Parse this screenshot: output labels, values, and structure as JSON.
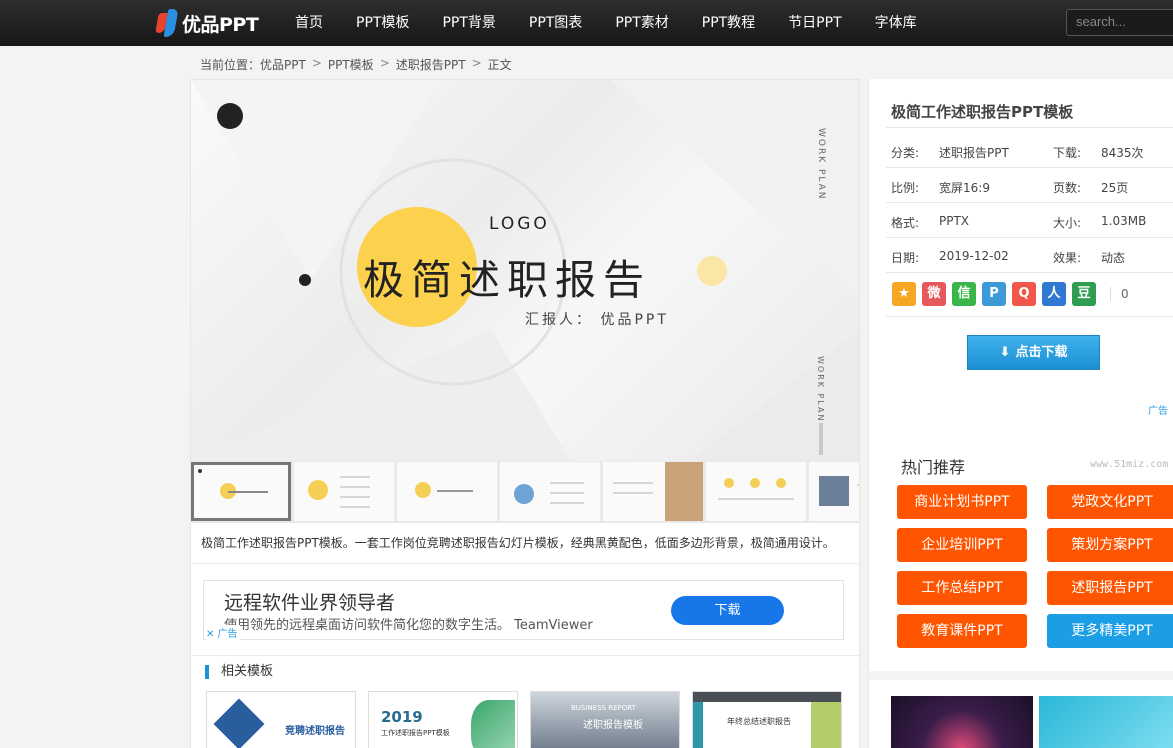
{
  "header": {
    "logo_text": "优品PPT",
    "nav": [
      "首页",
      "PPT模板",
      "PPT背景",
      "PPT图表",
      "PPT素材",
      "PPT教程",
      "节日PPT",
      "字体库"
    ],
    "search_placeholder": "search..."
  },
  "breadcrumb": [
    "当前位置：优品PPT",
    "PPT模板",
    "述职报告PPT",
    "正文"
  ],
  "breadcrumb_sep": ">",
  "preview": {
    "logo": "LOGO",
    "title": "极简述职报告",
    "reporter": "汇报人： 优品PPT",
    "side_text": "WORK PLAN",
    "side_text_2": "WORK PLAN"
  },
  "description": "极简工作述职报告PPT模板。一套工作岗位竞聘述职报告幻灯片模板，经典黑黄配色，低面多边形背景，极简通用设计。",
  "ad": {
    "title": "远程软件业界领导者",
    "subtitle": "使用领先的远程桌面访问软件简化您的数字生活。 TeamViewer",
    "button": "下载",
    "tag": "✕ 广告"
  },
  "related": {
    "title": "相关模板",
    "thumbs": [
      "竞聘述职报告",
      "2019",
      "工作述职报告PPT模板",
      "BUSINESS REPORT",
      "述职报告模板",
      "年终总结述职报告"
    ]
  },
  "sidebar": {
    "title": "极简工作述职报告PPT模板",
    "meta": [
      {
        "label": "分类:",
        "value": "述职报告PPT",
        "label2": "下载:",
        "value2": "8435次"
      },
      {
        "label": "比例:",
        "value": "宽屏16:9",
        "label2": "页数:",
        "value2": "25页"
      },
      {
        "label": "格式:",
        "value": "PPTX",
        "label2": "大小:",
        "value2": "1.03MB"
      },
      {
        "label": "日期:",
        "value": "2019-12-02",
        "label2": "效果:",
        "value2": "动态"
      }
    ],
    "share_icons": [
      {
        "name": "qzone-icon",
        "glyph": "★",
        "color": "#f5a623"
      },
      {
        "name": "weibo-icon",
        "glyph": "微",
        "color": "#e6595b"
      },
      {
        "name": "wechat-icon",
        "glyph": "信",
        "color": "#3ab54a"
      },
      {
        "name": "tieba-icon",
        "glyph": "P",
        "color": "#3c9ad8"
      },
      {
        "name": "qq-icon",
        "glyph": "Q",
        "color": "#f0564a"
      },
      {
        "name": "renren-icon",
        "glyph": "人",
        "color": "#2f79d3"
      },
      {
        "name": "douban-icon",
        "glyph": "豆",
        "color": "#2f9e52"
      }
    ],
    "share_count": "0",
    "download_button": "点击下载",
    "ad_tag": "广告",
    "hot_title": "热门推荐",
    "watermark": "www.51miz.com",
    "hot": [
      {
        "label": "商业计划书PPT",
        "color": "orange"
      },
      {
        "label": "党政文化PPT",
        "color": "orange"
      },
      {
        "label": "企业培训PPT",
        "color": "orange"
      },
      {
        "label": "策划方案PPT",
        "color": "orange"
      },
      {
        "label": "工作总结PPT",
        "color": "orange"
      },
      {
        "label": "述职报告PPT",
        "color": "orange"
      },
      {
        "label": "教育课件PPT",
        "color": "orange"
      },
      {
        "label": "更多精美PPT",
        "color": "blue"
      }
    ]
  }
}
